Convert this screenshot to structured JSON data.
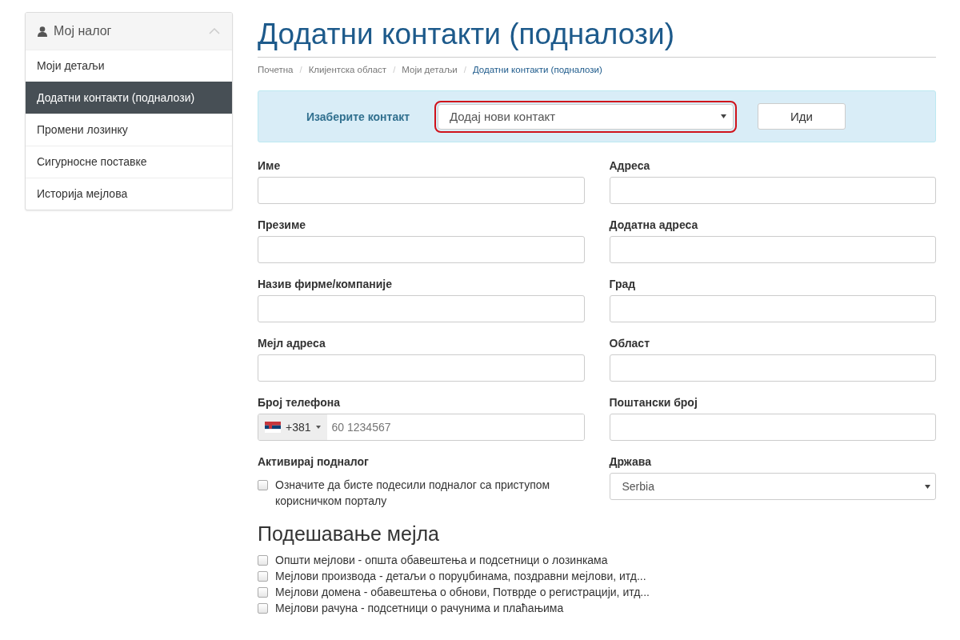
{
  "sidebar": {
    "title": "Мој налог",
    "expanded": true,
    "items": [
      {
        "label": "Моји детаљи",
        "selected": false
      },
      {
        "label": "Додатни контакти (подналози)",
        "selected": true
      },
      {
        "label": "Промени лозинку",
        "selected": false
      },
      {
        "label": "Сигурносне поставке",
        "selected": false
      },
      {
        "label": "Историја мејлова",
        "selected": false
      }
    ]
  },
  "page_title": "Додатни контакти (подналози)",
  "breadcrumb": [
    {
      "label": "Почетна",
      "current": false
    },
    {
      "separator": "/",
      "label": "Клијентска област",
      "current": false
    },
    {
      "separator": "/",
      "label": "Моји детаљи",
      "current": false
    },
    {
      "separator": "/",
      "label": "Додатни контакти (подналози)",
      "current": true
    }
  ],
  "contact_selector": {
    "label": "Изаберите контакт",
    "value": "Додај нови контакт",
    "highlighted": true,
    "button": "Иди"
  },
  "form": {
    "left": [
      {
        "kind": "text",
        "label": "Име"
      },
      {
        "kind": "text",
        "label": "Презиме"
      },
      {
        "kind": "text",
        "label": "Назив фирме/компаније"
      },
      {
        "kind": "text",
        "label": "Мејл адреса"
      },
      {
        "kind": "phone",
        "label": "Број телефона",
        "dial_code": "+381",
        "placeholder": "60 1234567"
      },
      {
        "kind": "checkbox",
        "label": "Активирај подналог",
        "text": "Означите да бисте подесили подналог са приступом корисничком порталу",
        "checked": false
      }
    ],
    "right": [
      {
        "kind": "text",
        "label": "Адреса"
      },
      {
        "kind": "text",
        "label": "Додатна адреса"
      },
      {
        "kind": "text",
        "label": "Град"
      },
      {
        "kind": "text",
        "label": "Област"
      },
      {
        "kind": "text",
        "label": "Поштански број"
      },
      {
        "kind": "select",
        "label": "Држава",
        "value": "Serbia"
      }
    ]
  },
  "email_settings": {
    "title": "Подешавање мејла",
    "options": [
      {
        "label": "Општи мејлови - општа обавештења и подсетници о лозинкама",
        "checked": false
      },
      {
        "label": "Мејлови производа - детаљи о поруџбинама, поздравни мејлови, итд...",
        "checked": false
      },
      {
        "label": "Мејлови домена - обавештења о обнови, Потврде о регистрацији, итд...",
        "checked": false
      },
      {
        "label": "Мејлови рачуна - подсетници о рачунима и плаћањима",
        "checked": false
      }
    ]
  }
}
